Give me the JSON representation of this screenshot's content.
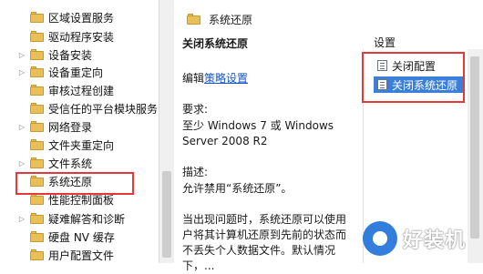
{
  "tree": {
    "items": [
      {
        "label": "区域设置服务",
        "arrow": ""
      },
      {
        "label": "驱动程序安装",
        "arrow": ""
      },
      {
        "label": "设备安装",
        "arrow": "▷"
      },
      {
        "label": "设备重定向",
        "arrow": "▷"
      },
      {
        "label": "审核过程创建",
        "arrow": ""
      },
      {
        "label": "受信任的平台模块服务",
        "arrow": ""
      },
      {
        "label": "网络登录",
        "arrow": "▷"
      },
      {
        "label": "文件夹重定向",
        "arrow": ""
      },
      {
        "label": "文件系统",
        "arrow": "▷"
      },
      {
        "label": "系统还原",
        "arrow": ""
      },
      {
        "label": "性能控制面板",
        "arrow": ""
      },
      {
        "label": "疑难解答和诊断",
        "arrow": "▷"
      },
      {
        "label": "硬盘 NV 缓存",
        "arrow": ""
      },
      {
        "label": "用户配置文件",
        "arrow": ""
      }
    ]
  },
  "header": {
    "title": "系统还原"
  },
  "description": {
    "policy_title": "关闭系统还原",
    "edit_prefix": "编辑",
    "edit_link": "策略设置",
    "requirements_label": "要求:",
    "requirements_line1": "至少 Windows 7 或 Windows",
    "requirements_line2": "Server 2008 R2",
    "description_label": "描述:",
    "description_text": "允许禁用“系统还原”。",
    "detail_line1": "当出现问题时，系统还原可以使用",
    "detail_line2": "户将其计算机还原到先前的状态而",
    "detail_line3": "不丢失个人数据文件。默认情况",
    "detail_line4": "下，..."
  },
  "settings": {
    "column_header": "设置",
    "items": [
      {
        "label": "关闭配置",
        "selected": false
      },
      {
        "label": "关闭系统还原",
        "selected": true
      }
    ]
  },
  "watermark": {
    "text": "好装机"
  },
  "colors": {
    "highlight": "#e4393c",
    "selection": "#3a7fd9",
    "folder": "#e8c057"
  }
}
